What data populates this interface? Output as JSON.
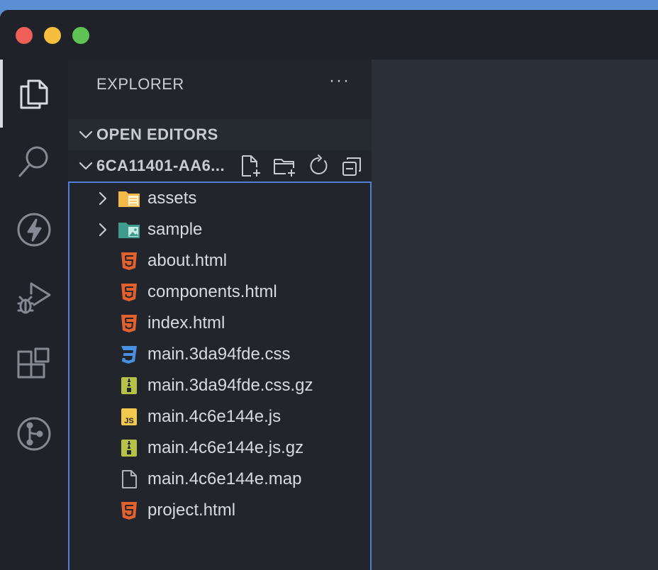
{
  "window": {
    "traffic_lights": [
      "close",
      "minimize",
      "zoom"
    ]
  },
  "activity_bar": {
    "items": [
      {
        "name": "explorer-icon",
        "active": true
      },
      {
        "name": "search-icon",
        "active": false
      },
      {
        "name": "lightning-icon",
        "active": false
      },
      {
        "name": "run-debug-icon",
        "active": false
      },
      {
        "name": "extensions-icon",
        "active": false
      },
      {
        "name": "source-control-icon",
        "active": false
      }
    ]
  },
  "sidebar": {
    "title": "EXPLORER",
    "more_label": "···",
    "open_editors_label": "OPEN EDITORS",
    "root_folder_label": "6CA11401-AA6...",
    "root_actions": [
      "new-file-icon",
      "new-folder-icon",
      "refresh-icon",
      "collapse-all-icon"
    ]
  },
  "tree": {
    "items": [
      {
        "label": "assets",
        "kind": "folder",
        "icon": "folder-assets-icon"
      },
      {
        "label": "sample",
        "kind": "folder",
        "icon": "folder-images-icon"
      },
      {
        "label": "about.html",
        "kind": "file",
        "icon": "html-file-icon"
      },
      {
        "label": "components.html",
        "kind": "file",
        "icon": "html-file-icon"
      },
      {
        "label": "index.html",
        "kind": "file",
        "icon": "html-file-icon"
      },
      {
        "label": "main.3da94fde.css",
        "kind": "file",
        "icon": "css-file-icon"
      },
      {
        "label": "main.3da94fde.css.gz",
        "kind": "file",
        "icon": "archive-file-icon"
      },
      {
        "label": "main.4c6e144e.js",
        "kind": "file",
        "icon": "js-file-icon"
      },
      {
        "label": "main.4c6e144e.js.gz",
        "kind": "file",
        "icon": "archive-file-icon"
      },
      {
        "label": "main.4c6e144e.map",
        "kind": "file",
        "icon": "generic-file-icon"
      },
      {
        "label": "project.html",
        "kind": "file",
        "icon": "html-file-icon"
      }
    ]
  },
  "colors": {
    "html": "#e4612e",
    "css": "#4a90e2",
    "js_bg": "#f2c94c",
    "archive": "#b5c246",
    "folder": "#f0b94a",
    "folder_images": "#3f9b8e",
    "focus_border": "#4f7fd7"
  }
}
